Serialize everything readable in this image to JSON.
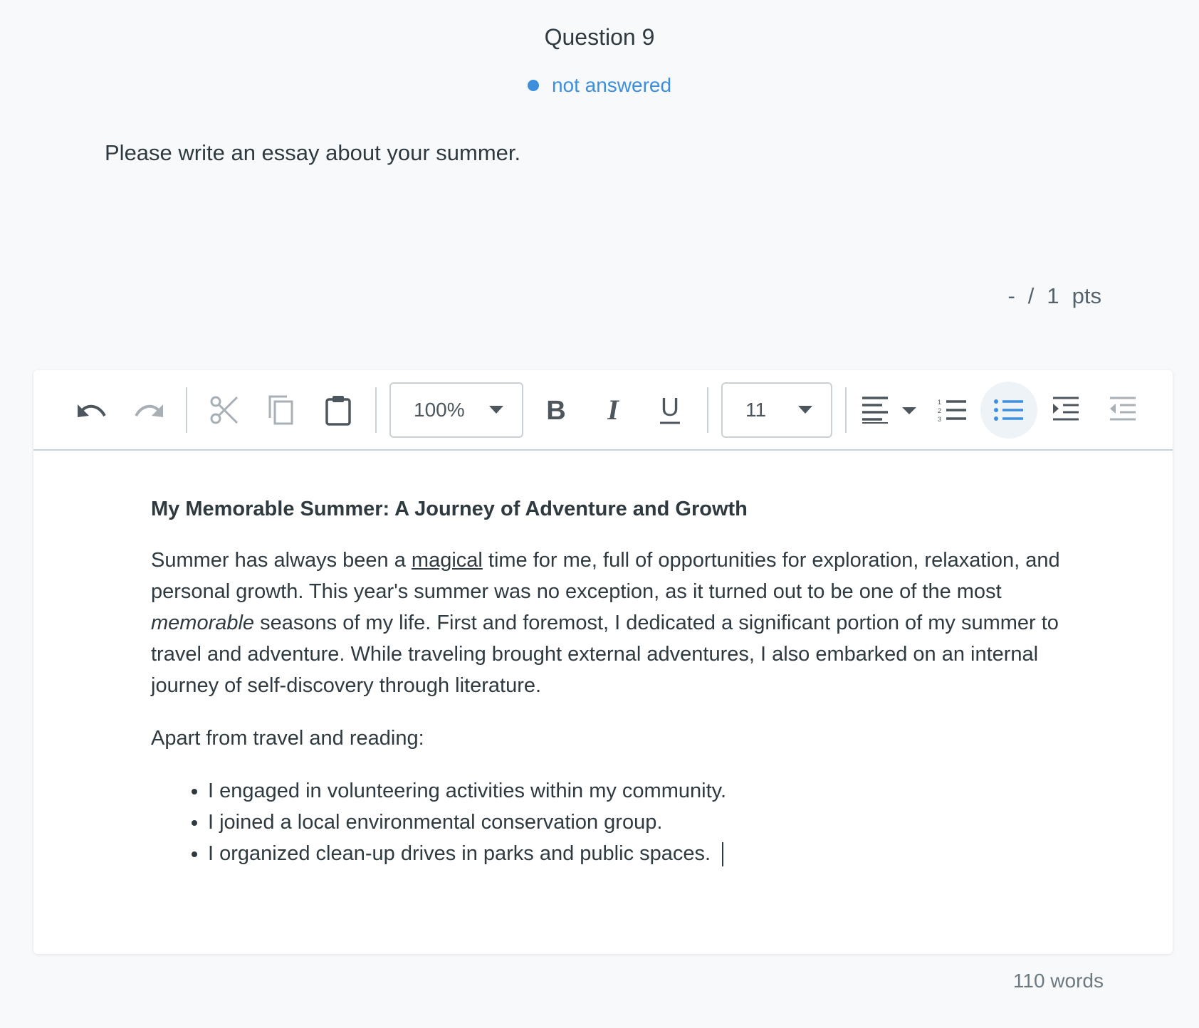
{
  "question": {
    "title": "Question 9",
    "status": "not answered",
    "prompt": "Please write an essay about your summer.",
    "points": {
      "earned": "-",
      "separator": "/",
      "total": "1",
      "unit": "pts"
    }
  },
  "toolbar": {
    "zoom_value": "100%",
    "font_size_value": "11",
    "buttons": [
      "undo-icon",
      "redo-icon",
      "cut-icon",
      "copy-icon",
      "paste-icon",
      "bold-icon",
      "italic-icon",
      "underline-icon",
      "align-left-icon",
      "numbered-list-icon",
      "bulleted-list-icon",
      "indent-icon",
      "outdent-icon"
    ],
    "active_button": "bulleted-list"
  },
  "essay": {
    "heading": "My Memorable Summer: A Journey of Adventure and Growth",
    "p1_a": "Summer has always been a ",
    "p1_underlined": "magical",
    "p1_b": " time for me, full of opportunities for exploration, relaxation, and personal growth. This year's summer was no exception, as it turned out to be one of the most ",
    "p1_italic": "memorable",
    "p1_c": " seasons of my life. First and foremost, I dedicated a significant portion of my summer to travel and adventure. While traveling brought external adventures, I also embarked on an internal journey of self-discovery through literature.",
    "p2": "Apart from travel and reading:",
    "bullets": [
      "I engaged in volunteering activities within my community.",
      "I joined a local environmental conservation group.",
      "I organized clean-up drives in parks and public spaces. "
    ]
  },
  "word_count": "110 words",
  "colors": {
    "accent": "#3e8ede",
    "text": "#2f3a40",
    "border": "#c9d0d6"
  }
}
